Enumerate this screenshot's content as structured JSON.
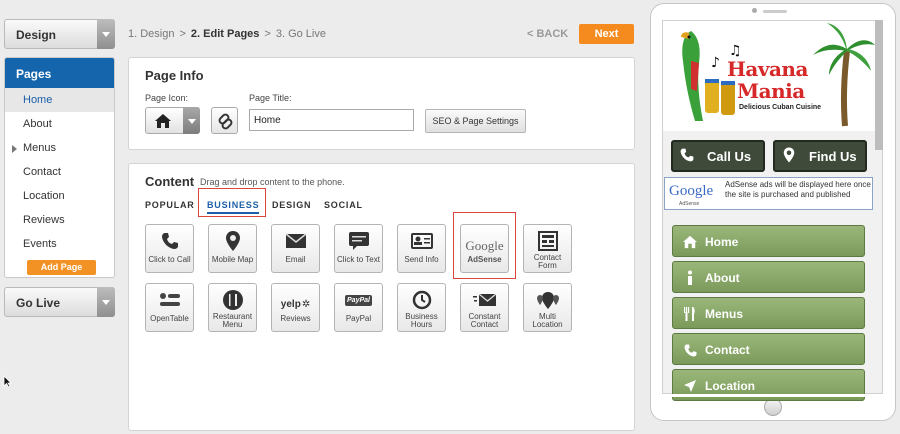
{
  "sidebar": {
    "design_label": "Design",
    "pages_title": "Pages",
    "pages": [
      "Home",
      "About",
      "Menus",
      "Contact",
      "Location",
      "Reviews",
      "Events"
    ],
    "add_page_label": "Add Page",
    "go_live_label": "Go Live"
  },
  "steps": {
    "step1": "1. Design",
    "step2": "2. Edit Pages",
    "step3": "3. Go Live",
    "back_label": "< BACK",
    "next_label": "Next"
  },
  "page_info": {
    "title": "Page Info",
    "icon_label": "Page Icon:",
    "page_title_label": "Page Title:",
    "page_title_value": "Home",
    "seo_button": "SEO & Page Settings"
  },
  "content": {
    "title": "Content",
    "hint": "Drag and drop content to the phone.",
    "tabs": [
      "POPULAR",
      "BUSINESS",
      "DESIGN",
      "SOCIAL"
    ],
    "active_tab": "BUSINESS",
    "tiles": [
      {
        "label": "Click to Call",
        "icon": "phone-icon"
      },
      {
        "label": "Mobile Map",
        "icon": "map-pin-icon"
      },
      {
        "label": "Email",
        "icon": "envelope-icon"
      },
      {
        "label": "Click to Text",
        "icon": "chat-icon"
      },
      {
        "label": "Send Info",
        "icon": "contact-card-icon"
      },
      {
        "label": "AdSense",
        "icon": "google-logo"
      },
      {
        "label": "Contact Form",
        "icon": "form-icon"
      },
      {
        "label": "OpenTable",
        "icon": "opentable-icon"
      },
      {
        "label": "Restaurant Menu",
        "icon": "fork-knife-icon"
      },
      {
        "label": "Reviews",
        "icon": "yelp-logo"
      },
      {
        "label": "PayPal",
        "icon": "paypal-logo"
      },
      {
        "label": "Business Hours",
        "icon": "clock-icon"
      },
      {
        "label": "Constant Contact",
        "icon": "mail-fast-icon"
      },
      {
        "label": "Multi Location",
        "icon": "multi-pin-icon"
      }
    ],
    "google_text": "Google",
    "yelp_text": "yelp",
    "paypal_text": "PayPal"
  },
  "phone": {
    "logo_line1": "Havana",
    "logo_line2": "Mania",
    "logo_tagline": "Delicious Cuban Cuisine",
    "call_label": "Call Us",
    "find_label": "Find Us",
    "adsense_logo": "Google",
    "adsense_sub": "AdSense",
    "adsense_text": "AdSense ads will be displayed here once the site is purchased and published",
    "nav": [
      {
        "label": "Home",
        "icon": "home-icon"
      },
      {
        "label": "About",
        "icon": "info-icon"
      },
      {
        "label": "Menus",
        "icon": "fork-knife-icon"
      },
      {
        "label": "Contact",
        "icon": "phone-icon"
      },
      {
        "label": "Location",
        "icon": "location-arrow-icon"
      }
    ]
  },
  "colors": {
    "primary_blue": "#1565ad",
    "accent_orange": "#f58a1f",
    "nav_green": "#86a866",
    "highlight_red": "#d9463b"
  }
}
